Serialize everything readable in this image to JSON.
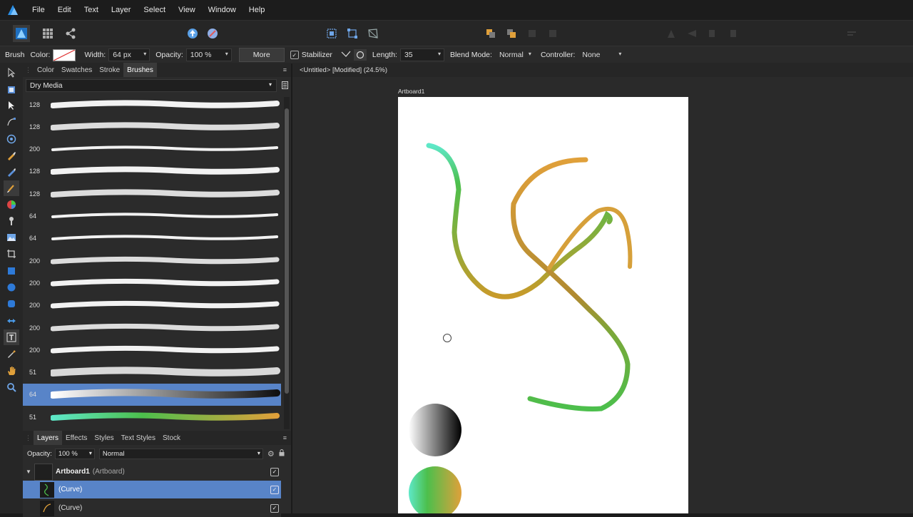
{
  "menu": [
    "File",
    "Edit",
    "Text",
    "Layer",
    "Select",
    "View",
    "Window",
    "Help"
  ],
  "context_bar": {
    "tool_name": "Brush",
    "color_label": "Color:",
    "width_label": "Width:",
    "width_value": "64 px",
    "opacity_label": "Opacity:",
    "opacity_value": "100 %",
    "more_label": "More",
    "stabilizer_label": "Stabilizer",
    "length_label": "Length:",
    "length_value": "35",
    "blend_label": "Blend Mode:",
    "blend_value": "Normal",
    "controller_label": "Controller:",
    "controller_value": "None"
  },
  "brush_panel": {
    "tabs": [
      "Color",
      "Swatches",
      "Stroke",
      "Brushes"
    ],
    "active_tab": "Brushes",
    "category": "Dry Media",
    "brushes": [
      "128",
      "128",
      "200",
      "128",
      "128",
      "64",
      "64",
      "200",
      "200",
      "200",
      "200",
      "200",
      "51",
      "64",
      "51"
    ],
    "selected_index": 13
  },
  "layers_panel": {
    "tabs": [
      "Layers",
      "Effects",
      "Styles",
      "Text Styles",
      "Stock"
    ],
    "active_tab": "Layers",
    "opacity_label": "Opacity:",
    "opacity_value": "100 %",
    "blend_value": "Normal",
    "rows": [
      {
        "name": "Artboard1",
        "type": "(Artboard)"
      },
      {
        "name": "(Curve)"
      },
      {
        "name": "(Curve)"
      }
    ]
  },
  "document": {
    "tab_title": "<Untitled> [Modified] (24.5%)",
    "artboard_label": "Artboard1"
  },
  "colors": {
    "accent": "#5884c8",
    "brand": "#1e90ff",
    "green": "#4cbf4c",
    "cyan": "#5ee8c8",
    "orange": "#e0a03a"
  }
}
